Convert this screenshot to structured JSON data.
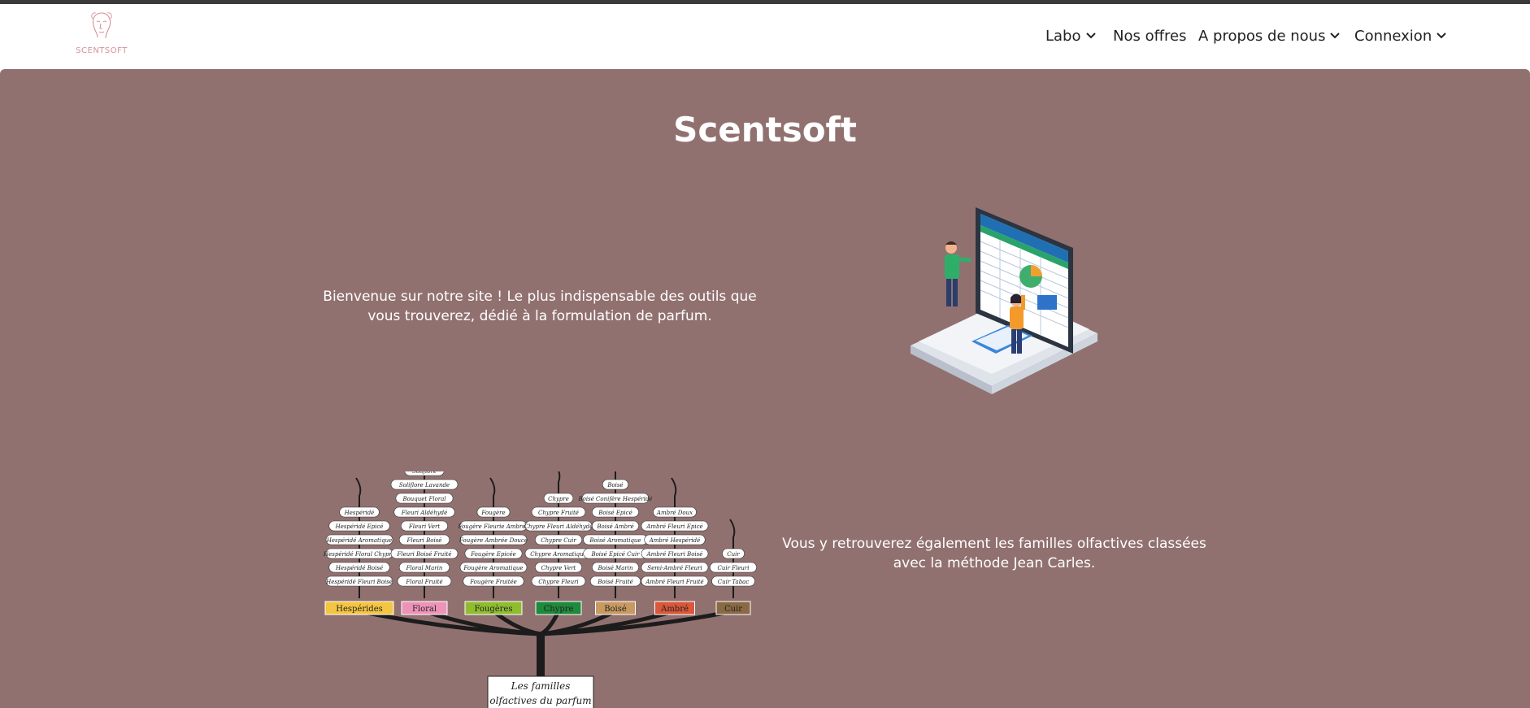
{
  "brand": {
    "name": "SCENTSOFT"
  },
  "nav": {
    "items": [
      {
        "label": "Labo",
        "dropdown": true
      },
      {
        "label": "Nos offres",
        "dropdown": false
      },
      {
        "label": "A propos de nous",
        "dropdown": true
      },
      {
        "label": "Connexion",
        "dropdown": true
      }
    ]
  },
  "hero": {
    "title": "Scentsoft",
    "intro": "Bienvenue sur notre site ! Le plus indispensable des outils que vous trouverez, dédié à la formulation de parfum.",
    "families_text": "Vous y retrouverez également les familles olfactives classées avec la méthode Jean Carles."
  },
  "tree": {
    "caption_lines": [
      "Les familles",
      "olfactives du parfum"
    ],
    "families": [
      {
        "name": "Hespérides",
        "color": "#f4c542",
        "subs": [
          "Hespéridé",
          "Hespéridé Epicé",
          "Hespéridé Aromatique",
          "Hespéridé Floral Chypré",
          "Hespéridé Boisé",
          "Hespéridé Fleuri Boisé"
        ]
      },
      {
        "name": "Floral",
        "color": "#ee93b8",
        "subs": [
          "Soliflore",
          "Soliflore Lavande",
          "Bouquet Floral",
          "Fleuri Aldéhydé",
          "Fleuri Vert",
          "Fleuri Boisé",
          "Fleuri Boisé Fruité",
          "Floral Marin",
          "Floral Fruité"
        ]
      },
      {
        "name": "Fougères",
        "color": "#8fbd2f",
        "subs": [
          "Fougère",
          "Fougère Fleurie Ambrée",
          "Fougère Ambrée Douce",
          "Fougère Epicée",
          "Fougère Aromatique",
          "Fougère Fruitée"
        ]
      },
      {
        "name": "Chypre",
        "color": "#1e8a3b",
        "subs": [
          "Chypre",
          "Chypre Fruité",
          "Chypre Fleuri Aldéhydé",
          "Chypre Cuir",
          "Chypre Aromatique",
          "Chypre Vert",
          "Chypre Fleuri"
        ]
      },
      {
        "name": "Boisé",
        "color": "#c89a62",
        "subs": [
          "Boisé",
          "Boisé Conifère Hespéridé",
          "Boisé Epicé",
          "Boisé Ambré",
          "Boisé Aromatique",
          "Boisé Epicé Cuir",
          "Boisé Marin",
          "Boisé Fruité"
        ]
      },
      {
        "name": "Ambré",
        "color": "#d9573a",
        "subs": [
          "Ambré Doux",
          "Ambré Fleuri Epicé",
          "Ambré Hespéridé",
          "Ambré Fleuri Boisé",
          "Semi-Ambré Fleuri",
          "Ambré Fleuri Fruité"
        ]
      },
      {
        "name": "Cuir",
        "color": "#8a6a45",
        "subs": [
          "Cuir",
          "Cuir Fleuri",
          "Cuir Tabac"
        ]
      }
    ]
  },
  "colors": {
    "hero_bg": "#917170",
    "logo": "#d4919a",
    "nav_text": "#222222"
  }
}
